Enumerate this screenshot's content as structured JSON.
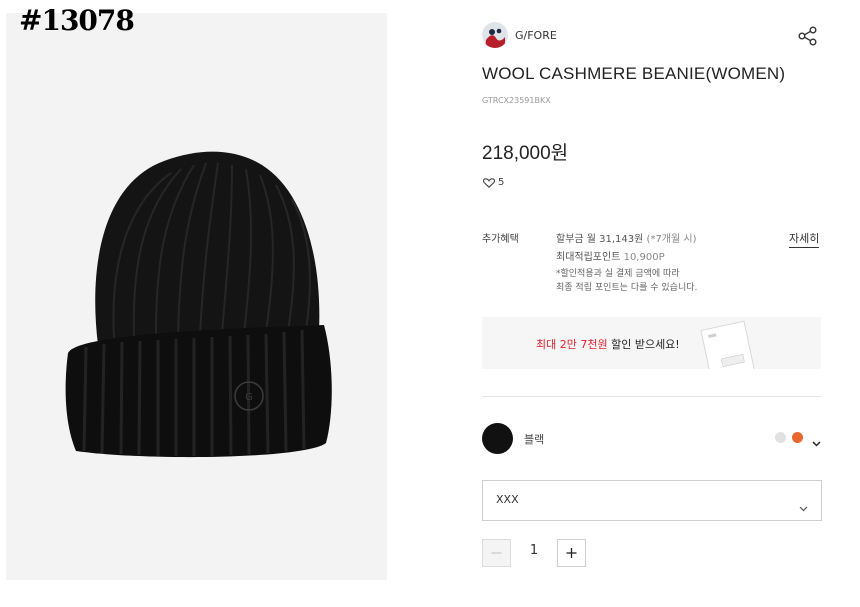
{
  "overlay_id": "#13078",
  "brand": {
    "name": "G/FORE",
    "logo_icon": "brand-logo-icon"
  },
  "product": {
    "title": "WOOL CASHMERE BEANIE(WOMEN)",
    "code": "GTRCX23591BKX",
    "price": "218,000원",
    "wish_count": "5"
  },
  "benefits": {
    "label": "추가혜택",
    "installment": "할부금 월 31,143원",
    "installment_note": " (*7개월 시)",
    "points_label": "최대적립포인트",
    "points_value": " 10,900P",
    "note_line1": "*할인적용과 실 결제 금액에 따라",
    "note_line2": "최종 적립 포인트는 다를 수 있습니다.",
    "detail_link": "자세히"
  },
  "coupon": {
    "highlight": "최대 2만 7천원",
    "text": " 할인 받으세요!",
    "highlight_color": "#e4202a"
  },
  "color_option": {
    "selected_name": "블랙",
    "swatch_colors": [
      "#111111",
      "#e1e1e1",
      "#e8672c"
    ]
  },
  "size_option": {
    "selected": "XXX"
  },
  "quantity": {
    "value": "1",
    "minus_label": "−",
    "plus_label": "+"
  },
  "icons": {
    "share": "share-icon",
    "wish": "heart-icon",
    "dropdown": "chevron-down-icon"
  }
}
